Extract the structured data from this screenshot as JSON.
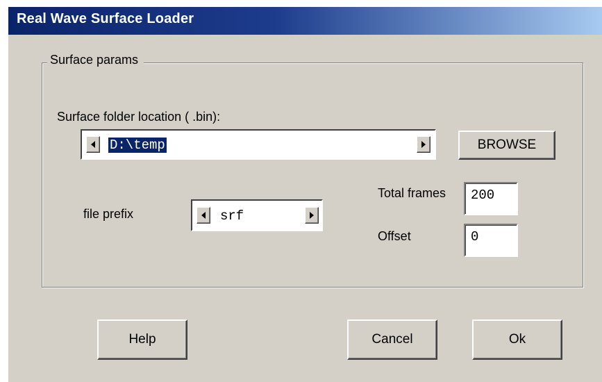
{
  "window": {
    "title": "Real Wave Surface Loader"
  },
  "group": {
    "label": "Surface params"
  },
  "surface_folder": {
    "label": "Surface folder location ( .bin):",
    "value": "D:\\temp",
    "browse_label": "BROWSE",
    "left_arrow_icon": "scroll-left-icon",
    "right_arrow_icon": "scroll-right-icon"
  },
  "file_prefix": {
    "label": "file prefix",
    "value": "srf",
    "left_arrow_icon": "scroll-left-icon",
    "right_arrow_icon": "scroll-right-icon"
  },
  "total_frames": {
    "label": "Total frames",
    "value": "200"
  },
  "offset": {
    "label": "Offset",
    "value": "0"
  },
  "buttons": {
    "help": "Help",
    "cancel": "Cancel",
    "ok": "Ok"
  }
}
